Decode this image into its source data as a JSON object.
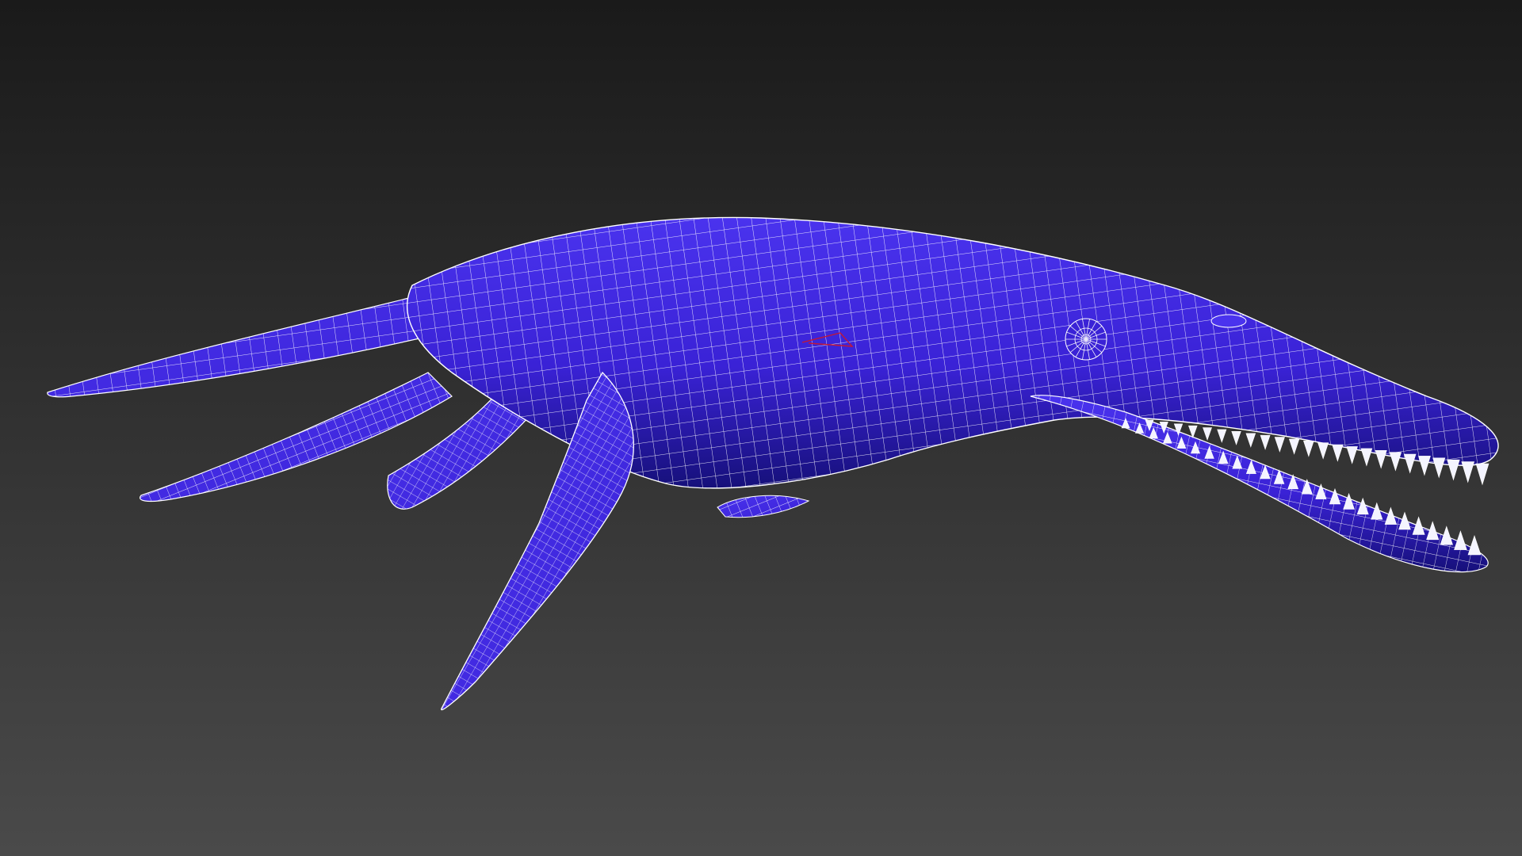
{
  "viewport": {
    "background_top": "#1a1a1a",
    "background_bottom": "#4a4a4a"
  },
  "model": {
    "subject": "marine-reptile-wireframe",
    "shade_color": "#3a22d6",
    "shade_highlight": "#4a33ee",
    "shade_shadow": "#16107a",
    "wire_color": "#ffffff",
    "tooth_color": "#f4f4ff",
    "selection_color": "#c0183a"
  }
}
